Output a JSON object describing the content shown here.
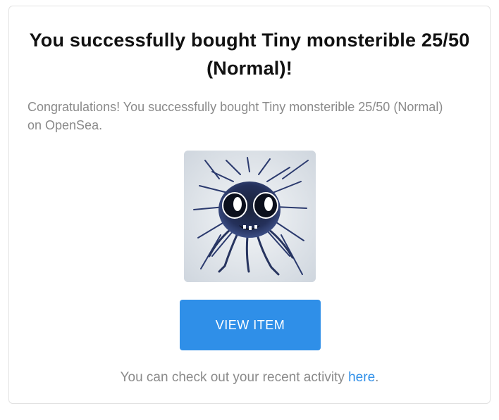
{
  "email": {
    "title": "You successfully bought Tiny monsterible 25/50 (Normal)!",
    "message": "Congratulations! You successfully bought Tiny monsterible 25/50 (Normal) on OpenSea.",
    "item_image_icon": "monster-nft-image",
    "button_label": "VIEW ITEM",
    "footer_prefix": "You can check out your recent activity ",
    "footer_link_label": "here",
    "footer_suffix": "."
  },
  "colors": {
    "accent": "#2f8fe8",
    "muted_text": "#8a8a8a",
    "title_text": "#111111",
    "card_border": "#e2e2e2"
  }
}
